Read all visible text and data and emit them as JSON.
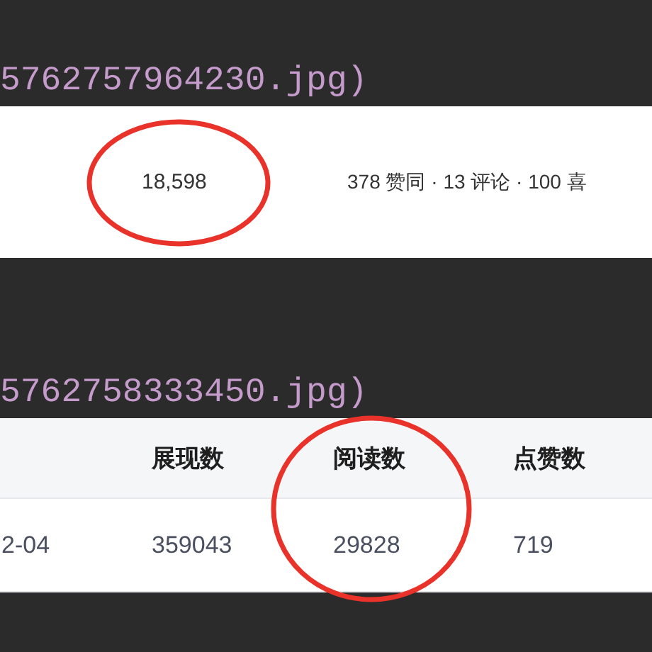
{
  "sections": [
    {
      "kind": "code",
      "text": "5762757964230.jpg)"
    },
    {
      "kind": "stats",
      "value": "18,598",
      "value_circled": true,
      "summary": "378 赞同 · 13 评论 · 100 喜"
    },
    {
      "kind": "code",
      "text": "5762758333450.jpg)"
    },
    {
      "kind": "table",
      "columns": [
        null,
        {
          "label": "展现数",
          "circled": false
        },
        {
          "label": "阅读数",
          "circled": true
        },
        {
          "label": "点赞数",
          "circled": false
        }
      ],
      "rows": [
        [
          "2-04",
          "359043",
          "29828",
          "719"
        ]
      ]
    }
  ]
}
